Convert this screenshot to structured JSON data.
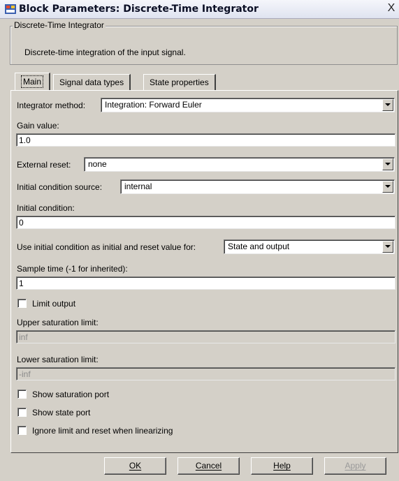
{
  "window": {
    "title": "Block Parameters: Discrete-Time Integrator",
    "close_glyph": "X",
    "icon": "simulink-block-icon"
  },
  "group": {
    "legend": "Discrete-Time Integrator",
    "description": "Discrete-time integration of the input signal."
  },
  "tabs": [
    {
      "label": "Main",
      "active": true
    },
    {
      "label": "Signal data types",
      "active": false
    },
    {
      "label": "State properties",
      "active": false
    }
  ],
  "main": {
    "integrator_method": {
      "label": "Integrator method:",
      "value": "Integration: Forward Euler"
    },
    "gain": {
      "label": "Gain value:",
      "value": "1.0"
    },
    "external_reset": {
      "label": "External reset:",
      "value": "none"
    },
    "ic_source": {
      "label": "Initial condition source:",
      "value": "internal"
    },
    "initial_condition": {
      "label": "Initial condition:",
      "value": "0"
    },
    "ic_usage": {
      "label": "Use initial condition as initial and reset value for:",
      "value": "State and output"
    },
    "sample_time": {
      "label": "Sample time (-1 for inherited):",
      "value": "1"
    },
    "limit_output": {
      "label": "Limit output",
      "checked": false
    },
    "upper_limit": {
      "label": "Upper saturation limit:",
      "value": "inf",
      "disabled": true
    },
    "lower_limit": {
      "label": "Lower saturation limit:",
      "value": "-inf",
      "disabled": true
    },
    "show_saturation_port": {
      "label": "Show saturation port",
      "checked": false
    },
    "show_state_port": {
      "label": "Show state port",
      "checked": false
    },
    "ignore_limit": {
      "label": "Ignore limit and reset when linearizing",
      "checked": false
    }
  },
  "buttons": {
    "ok": "OK",
    "cancel": "Cancel",
    "help": "Help",
    "apply": "Apply",
    "apply_disabled": true
  }
}
